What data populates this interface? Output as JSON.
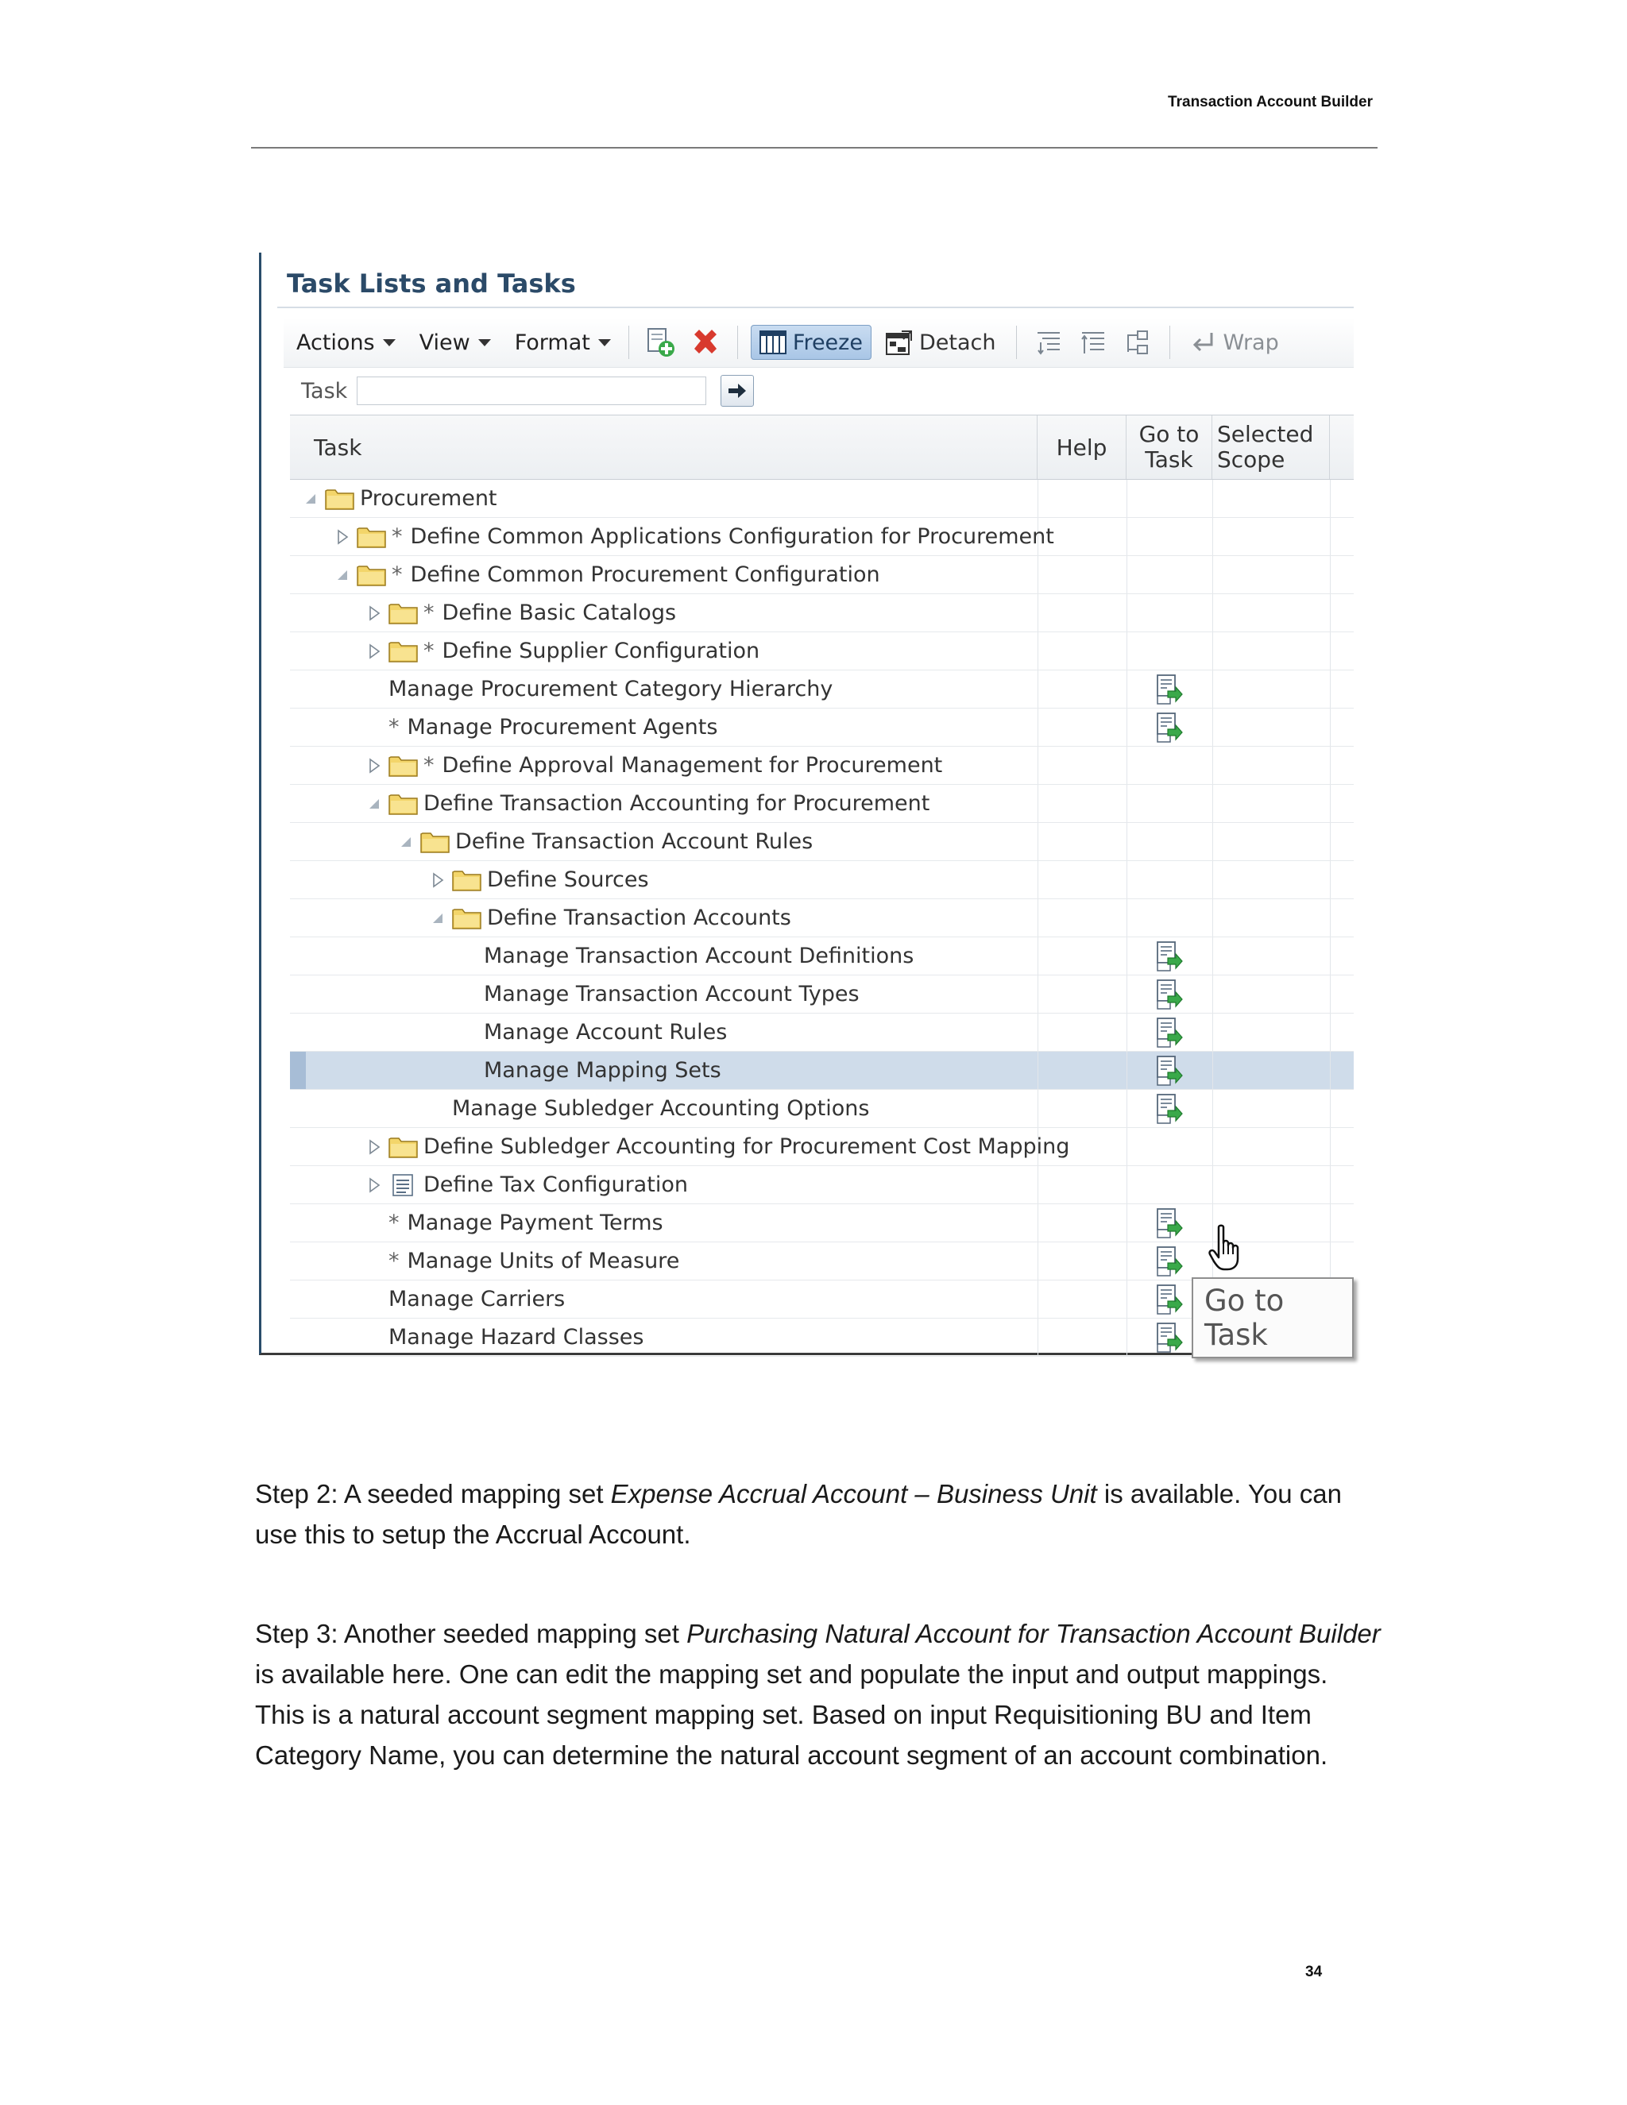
{
  "header": {
    "title": "Transaction Account Builder"
  },
  "panel": {
    "title": "Task Lists and Tasks",
    "toolbar": {
      "actions": "Actions",
      "view": "View",
      "format": "Format",
      "freeze": "Freeze",
      "detach": "Detach",
      "wrap": "Wrap"
    },
    "filter": {
      "label": "Task",
      "value": ""
    },
    "columns": {
      "task": "Task",
      "help": "Help",
      "goto_l1": "Go to",
      "goto_l2": "Task",
      "scope_l1": "Selected",
      "scope_l2": "Scope"
    },
    "rows": [
      {
        "label": "Procurement",
        "star": "",
        "depth": 0,
        "expander": "expanded",
        "icon": "folder",
        "goto": false
      },
      {
        "label": "Define Common Applications Configuration for Procurement",
        "star": "*",
        "depth": 1,
        "expander": "collapsed",
        "icon": "folder",
        "goto": false
      },
      {
        "label": "Define Common Procurement Configuration",
        "star": "*",
        "depth": 1,
        "expander": "expanded",
        "icon": "folder",
        "goto": false
      },
      {
        "label": "Define Basic Catalogs",
        "star": "*",
        "depth": 2,
        "expander": "collapsed",
        "icon": "folder",
        "goto": false
      },
      {
        "label": "Define Supplier Configuration",
        "star": "*",
        "depth": 2,
        "expander": "collapsed",
        "icon": "folder",
        "goto": false
      },
      {
        "label": "Manage Procurement Category Hierarchy",
        "star": "",
        "depth": 2,
        "expander": "none",
        "icon": "none",
        "goto": true
      },
      {
        "label": "Manage Procurement Agents",
        "star": "*",
        "depth": 2,
        "expander": "none",
        "icon": "none",
        "goto": true
      },
      {
        "label": "Define Approval Management for Procurement",
        "star": "*",
        "depth": 2,
        "expander": "collapsed",
        "icon": "folder",
        "goto": false
      },
      {
        "label": "Define Transaction Accounting for Procurement",
        "star": "",
        "depth": 2,
        "expander": "expanded",
        "icon": "folder",
        "goto": false
      },
      {
        "label": "Define Transaction Account Rules",
        "star": "",
        "depth": 3,
        "expander": "expanded",
        "icon": "folder",
        "goto": false
      },
      {
        "label": "Define Sources",
        "star": "",
        "depth": 4,
        "expander": "collapsed",
        "icon": "folder",
        "goto": false
      },
      {
        "label": "Define Transaction Accounts",
        "star": "",
        "depth": 4,
        "expander": "expanded",
        "icon": "folder",
        "goto": false
      },
      {
        "label": "Manage Transaction Account Definitions",
        "star": "",
        "depth": 5,
        "expander": "none",
        "icon": "none",
        "goto": true
      },
      {
        "label": "Manage Transaction Account Types",
        "star": "",
        "depth": 5,
        "expander": "none",
        "icon": "none",
        "goto": true
      },
      {
        "label": "Manage Account Rules",
        "star": "",
        "depth": 5,
        "expander": "none",
        "icon": "none",
        "goto": true
      },
      {
        "label": "Manage Mapping Sets",
        "star": "",
        "depth": 5,
        "expander": "none",
        "icon": "none",
        "goto": true,
        "selected": true
      },
      {
        "label": "Manage Subledger Accounting Options",
        "star": "",
        "depth": 4,
        "expander": "none",
        "icon": "none",
        "goto": true
      },
      {
        "label": "Define Subledger Accounting for Procurement Cost Mapping",
        "star": "",
        "depth": 2,
        "expander": "collapsed",
        "icon": "folder",
        "goto": false
      },
      {
        "label": "Define Tax Configuration",
        "star": "",
        "depth": 2,
        "expander": "collapsed",
        "icon": "list",
        "goto": false
      },
      {
        "label": "Manage Payment Terms",
        "star": "*",
        "depth": 2,
        "expander": "none",
        "icon": "none",
        "goto": true
      },
      {
        "label": "Manage Units of Measure",
        "star": "*",
        "depth": 2,
        "expander": "none",
        "icon": "none",
        "goto": true
      },
      {
        "label": "Manage Carriers",
        "star": "",
        "depth": 2,
        "expander": "none",
        "icon": "none",
        "goto": true
      },
      {
        "label": "Manage Hazard Classes",
        "star": "",
        "depth": 2,
        "expander": "none",
        "icon": "none",
        "goto": true
      }
    ],
    "tooltip": "Go to Task"
  },
  "body": {
    "step2": {
      "prefix": "Step 2: A seeded mapping set ",
      "italic": "Expense Accrual Account – Business Unit",
      "suffix": " is available. You can use this to setup the Accrual Account."
    },
    "step3": {
      "prefix": "Step 3: Another seeded mapping set ",
      "italic": "Purchasing Natural Account for Transaction Account Builder",
      "suffix": " is available here. One can edit the mapping set and populate the input and output mappings. This is a natural account segment mapping set. Based on input Requisitioning BU and Item Category Name, you can determine the natural account segment of an account combination."
    }
  },
  "footer": {
    "page_number": "34"
  },
  "colors": {
    "title_blue": "#2b4a68",
    "selected_row": "#cfdcea",
    "folder_yellow": "#f3d56a",
    "goto_green": "#3aa94a"
  }
}
